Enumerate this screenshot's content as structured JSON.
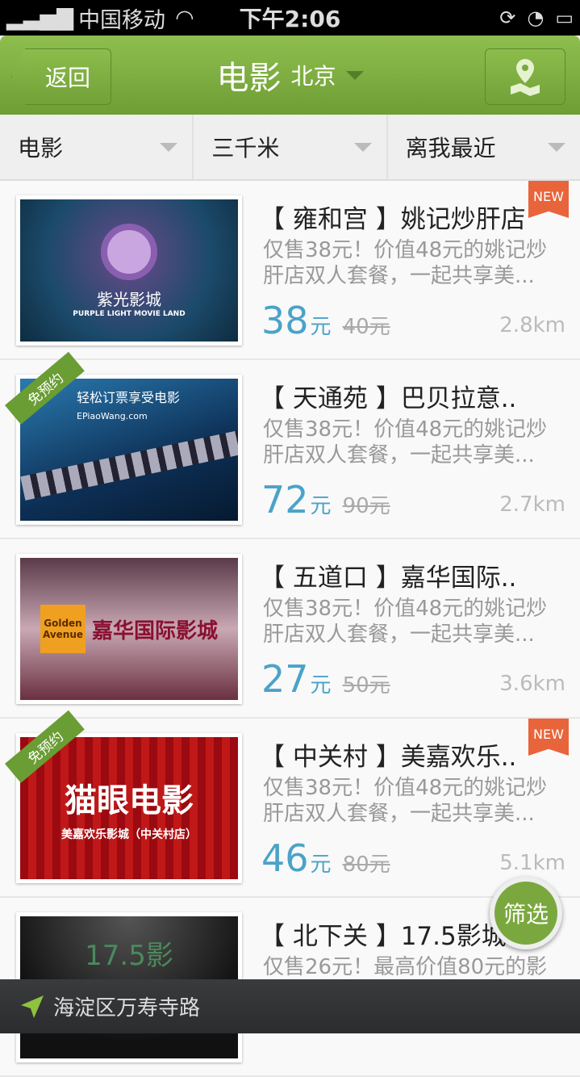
{
  "status": {
    "carrier": "中国移动",
    "time": "下午2:06"
  },
  "nav": {
    "back": "返回",
    "title": "电影",
    "city": "北京"
  },
  "filters": [
    "电影",
    "三千米",
    "离我最近"
  ],
  "items": [
    {
      "title": "【 雍和宫 】姚记炒肝店",
      "desc": "仅售38元！价值48元的姚记炒肝店双人套餐，一起共享美...",
      "price": "38",
      "unit": "元",
      "old": "40元",
      "dist": "2.8km",
      "new": "NEW",
      "logo": "紫光影城",
      "logo_sub": "PURPLE LIGHT MOVIE LAND"
    },
    {
      "title": "【 天通苑 】巴贝拉意..",
      "desc": "仅售38元！价值48元的姚记炒肝店双人套餐，一起共享美...",
      "price": "72",
      "unit": "元",
      "old": "90元",
      "dist": "2.7km",
      "ribbon": "免预约",
      "logo": "轻松订票享受电影",
      "logo_sub": "EPiaoWang.com"
    },
    {
      "title": "【 五道口 】嘉华国际..",
      "desc": "仅售38元！价值48元的姚记炒肝店双人套餐，一起共享美...",
      "price": "27",
      "unit": "元",
      "old": "50元",
      "dist": "3.6km",
      "logo": "嘉华国际影城",
      "logo_sub": "Golden Avenue"
    },
    {
      "title": "【 中关村 】美嘉欢乐..",
      "desc": "仅售38元！价值48元的姚记炒肝店双人套餐，一起共享美...",
      "price": "46",
      "unit": "元",
      "old": "80元",
      "dist": "5.1km",
      "new": "NEW",
      "ribbon": "免预约",
      "logo": "猫眼电影",
      "logo_sub": "美嘉欢乐影城（中关村店）"
    },
    {
      "title": "【 北下关 】17.5影城",
      "desc": "仅售26元！最高价值80元的影",
      "logo": "17.5影"
    }
  ],
  "fab": "筛选",
  "location": "海淀区万寿寺路"
}
